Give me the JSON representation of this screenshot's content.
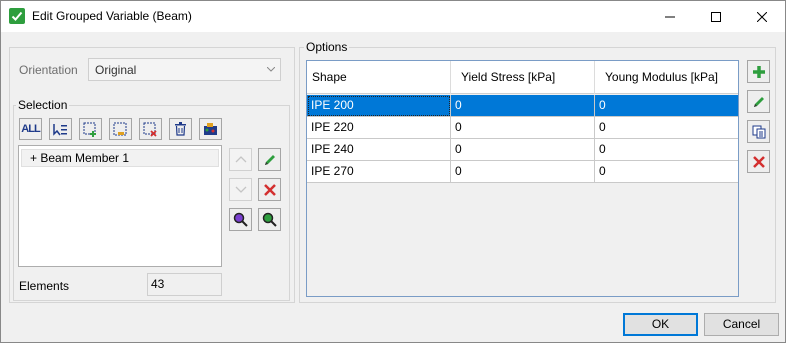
{
  "window": {
    "title": "Edit Grouped Variable (Beam)"
  },
  "orientation": {
    "label": "Orientation",
    "value": "Original"
  },
  "selection": {
    "title": "Selection",
    "toolbar": [
      {
        "name": "select-all-button",
        "icon": "ALL"
      },
      {
        "name": "select-pointer-button",
        "icon": "pointer-list-icon"
      },
      {
        "name": "add-selection-button",
        "icon": "add-select-icon"
      },
      {
        "name": "box-selection-button",
        "icon": "box-select-icon"
      },
      {
        "name": "remove-selection-button",
        "icon": "remove-select-icon"
      },
      {
        "name": "delete-selection-button",
        "icon": "trash-icon"
      },
      {
        "name": "paint-selection-button",
        "icon": "paint-icon"
      }
    ],
    "items": [
      {
        "label": "+ Beam Member 1"
      }
    ],
    "elements_label": "Elements",
    "elements_value": "43"
  },
  "options": {
    "title": "Options",
    "columns": [
      "Shape",
      "Yield Stress [kPa]",
      "Young Modulus [kPa]"
    ],
    "rows": [
      [
        "IPE 200",
        "0",
        "0"
      ],
      [
        "IPE 220",
        "0",
        "0"
      ],
      [
        "IPE 240",
        "0",
        "0"
      ],
      [
        "IPE 270",
        "0",
        "0"
      ]
    ],
    "selected_row": 0
  },
  "buttons": {
    "ok": "OK",
    "cancel": "Cancel"
  },
  "colors": {
    "accent": "#0078d7",
    "add": "#2e9e3e",
    "delete": "#d32f2f"
  }
}
